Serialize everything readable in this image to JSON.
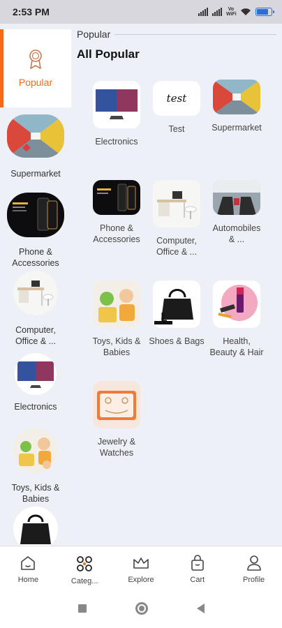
{
  "status_bar": {
    "time": "2:53 PM",
    "network": "Vo WiFi",
    "battery_level": 0.8
  },
  "sidebar": {
    "active": {
      "label": "Popular",
      "icon": "medal-icon"
    },
    "items": [
      {
        "label": "Supermarket",
        "icon": "supermarket-aisle"
      },
      {
        "label": "Phone &\nAccessories",
        "icon": "phone-promo"
      },
      {
        "label": "Computer,\nOffice & ...",
        "icon": "office-desk"
      },
      {
        "label": "Electronics",
        "icon": "monitor"
      },
      {
        "label": "Toys, Kids &\nBabies",
        "icon": "kid-toys"
      },
      {
        "label": "",
        "icon": "handbag"
      }
    ]
  },
  "main": {
    "section_label": "Popular",
    "title": "All Popular",
    "categories": [
      {
        "name": "Electronics",
        "icon": "monitor"
      },
      {
        "name": "Test",
        "icon": "test-script"
      },
      {
        "name": "Supermarket",
        "icon": "supermarket-aisle"
      },
      {
        "name": "Phone &\nAccessories",
        "icon": "phone-promo"
      },
      {
        "name": "Computer,\nOffice & ...",
        "icon": "office-desk"
      },
      {
        "name": "Automobiles\n& ...",
        "icon": "car-interior"
      },
      {
        "name": "Toys, Kids &\nBabies",
        "icon": "kid-toys"
      },
      {
        "name": "Shoes & Bags",
        "icon": "handbag"
      },
      {
        "name": "Health,\nBeauty & Hair",
        "icon": "cosmetics"
      },
      {
        "name": "Jewelry &\nWatches",
        "icon": "jewelry-box"
      }
    ]
  },
  "bottom_nav": [
    {
      "label": "Home",
      "icon": "home-icon"
    },
    {
      "label": "Categ...",
      "icon": "category-icon"
    },
    {
      "label": "Explore",
      "icon": "crown-icon"
    },
    {
      "label": "Cart",
      "icon": "bag-icon"
    },
    {
      "label": "Profile",
      "icon": "profile-icon"
    }
  ],
  "colors": {
    "accent": "#f26b1d",
    "background": "#eef0f8"
  }
}
